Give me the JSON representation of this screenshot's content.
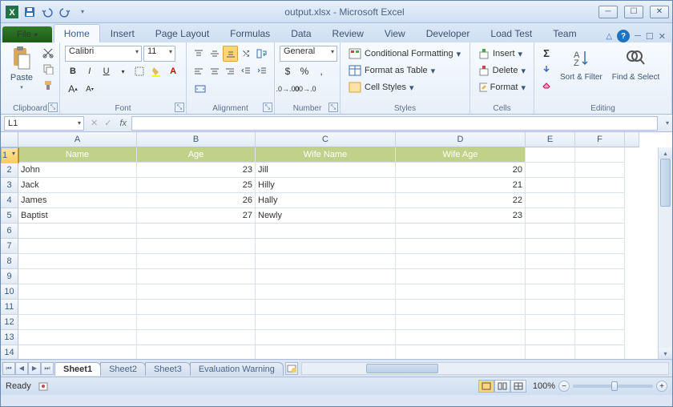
{
  "title": "output.xlsx - Microsoft Excel",
  "tabs": [
    "File",
    "Home",
    "Insert",
    "Page Layout",
    "Formulas",
    "Data",
    "Review",
    "View",
    "Developer",
    "Load Test",
    "Team"
  ],
  "activeTab": "Home",
  "clipboard": {
    "paste": "Paste",
    "label": "Clipboard"
  },
  "font": {
    "name": "Calibri",
    "size": "11",
    "label": "Font"
  },
  "alignment": {
    "label": "Alignment"
  },
  "number": {
    "format": "General",
    "label": "Number"
  },
  "styles": {
    "cond": "Conditional Formatting",
    "table": "Format as Table",
    "cell": "Cell Styles",
    "label": "Styles"
  },
  "cells": {
    "insert": "Insert",
    "delete": "Delete",
    "format": "Format",
    "label": "Cells"
  },
  "editing": {
    "sort": "Sort & Filter",
    "find": "Find & Select",
    "label": "Editing"
  },
  "namebox": "L1",
  "columns": [
    "A",
    "B",
    "C",
    "D",
    "E",
    "F"
  ],
  "headers": [
    "Name",
    "Age",
    "Wife Name",
    "Wife Age"
  ],
  "rows": [
    {
      "n": "2",
      "a": "John",
      "b": "23",
      "c": "Jill",
      "d": "20"
    },
    {
      "n": "3",
      "a": "Jack",
      "b": "25",
      "c": "Hilly",
      "d": "21"
    },
    {
      "n": "4",
      "a": "James",
      "b": "26",
      "c": "Hally",
      "d": "22"
    },
    {
      "n": "5",
      "a": "Baptist",
      "b": "27",
      "c": "Newly",
      "d": "23"
    }
  ],
  "emptyRows": [
    "6",
    "7",
    "8",
    "9",
    "10",
    "11",
    "12",
    "13",
    "14"
  ],
  "sheets": [
    "Sheet1",
    "Sheet2",
    "Sheet3",
    "Evaluation Warning"
  ],
  "activeSheet": "Sheet1",
  "status": "Ready",
  "zoom": "100%"
}
